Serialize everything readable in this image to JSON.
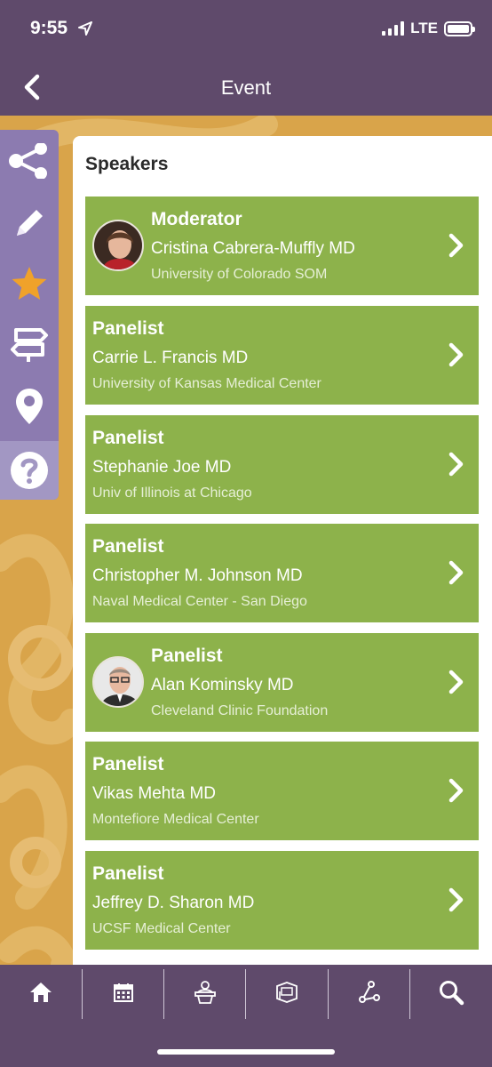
{
  "status_bar": {
    "time": "9:55",
    "network": "LTE"
  },
  "nav": {
    "title": "Event"
  },
  "rail": {
    "items": [
      {
        "icon": "share-icon"
      },
      {
        "icon": "pencil-icon"
      },
      {
        "icon": "star-icon"
      },
      {
        "icon": "signpost-icon"
      },
      {
        "icon": "location-pin-icon"
      },
      {
        "icon": "help-icon"
      }
    ]
  },
  "speakers": {
    "title": "Speakers",
    "list": [
      {
        "role": "Moderator",
        "name": "Cristina Cabrera-Muffly MD",
        "org": "University of Colorado SOM",
        "has_photo": true
      },
      {
        "role": "Panelist",
        "name": "Carrie L. Francis MD",
        "org": "University of Kansas Medical Center",
        "has_photo": false
      },
      {
        "role": "Panelist",
        "name": "Stephanie Joe MD",
        "org": "Univ of Illinois at Chicago",
        "has_photo": false
      },
      {
        "role": "Panelist",
        "name": "Christopher M. Johnson MD",
        "org": "Naval Medical Center - San Diego",
        "has_photo": false
      },
      {
        "role": "Panelist",
        "name": "Alan Kominsky MD",
        "org": "Cleveland Clinic Foundation",
        "has_photo": true
      },
      {
        "role": "Panelist",
        "name": "Vikas Mehta MD",
        "org": "Montefiore Medical Center",
        "has_photo": false
      },
      {
        "role": "Panelist",
        "name": "Jeffrey D. Sharon MD",
        "org": "UCSF Medical Center",
        "has_photo": false
      }
    ]
  },
  "tabbar": {
    "items": [
      {
        "icon": "home-icon"
      },
      {
        "icon": "calendar-icon"
      },
      {
        "icon": "podium-icon"
      },
      {
        "icon": "exhibit-booth-icon"
      },
      {
        "icon": "network-icon"
      },
      {
        "icon": "search-icon"
      }
    ]
  },
  "colors": {
    "header": "#5f4a6b",
    "background": "#d9a44a",
    "rail": "#8c7bb0",
    "card": "#8db24b",
    "star": "#f0a22a"
  }
}
